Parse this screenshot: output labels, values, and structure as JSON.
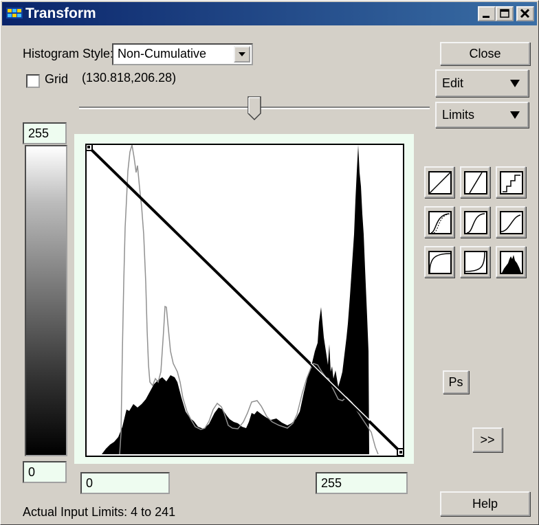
{
  "window": {
    "title": "Transform"
  },
  "controls": {
    "histogram_style_label": "Histogram Style:",
    "histogram_style_value": "Non-Cumulative",
    "grid_label": "Grid",
    "grid_checked": false,
    "coordinates": "(130.818,206.28)"
  },
  "buttons": {
    "close": "Close",
    "edit": "Edit",
    "limits": "Limits",
    "ps": "Ps",
    "expand": ">>",
    "help": "Help"
  },
  "output_range": {
    "max": "255",
    "min": "0"
  },
  "input_range": {
    "min": "0",
    "max": "255"
  },
  "status": {
    "actual_input_limits": "Actual Input Limits: 4 to 241"
  },
  "slider": {
    "position_percent": 51
  },
  "presets": [
    "linear-icon",
    "steep-linear-icon",
    "staircase-icon",
    "s-curve-dotted-icon",
    "s-curve-icon",
    "gentle-s-curve-icon",
    "log-curve-icon",
    "exp-curve-icon",
    "histogram-eq-icon"
  ],
  "colors": {
    "title_start": "#0a246a",
    "title_end": "#3a6ea5",
    "field_bg": "#eefcf0",
    "face": "#d4d0c8"
  }
}
